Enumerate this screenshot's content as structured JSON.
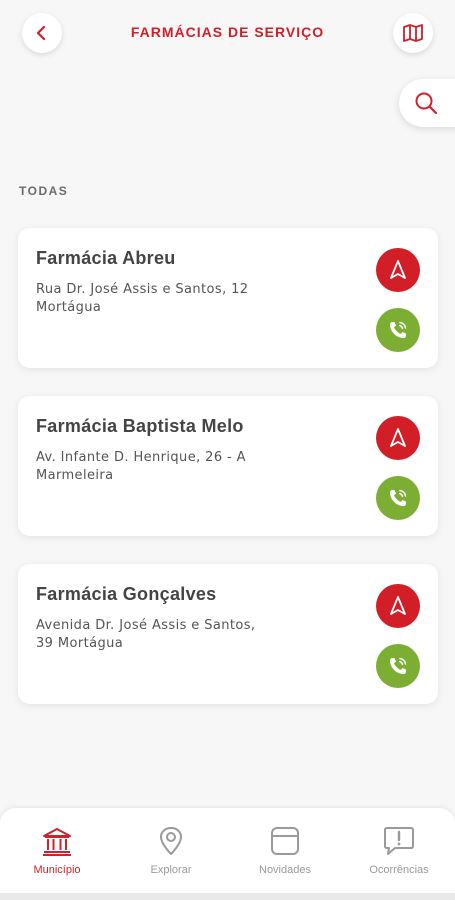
{
  "header": {
    "title": "FARMÁCIAS DE SERVIÇO",
    "back_icon": "chevron-left-icon",
    "map_icon": "map-icon",
    "search_icon": "search-icon"
  },
  "section": {
    "label": "TODAS"
  },
  "pharmacies": [
    {
      "name": "Farmácia Abreu",
      "address_line1": "Rua Dr. José Assis e Santos, 12",
      "address_line2": "Mortágua"
    },
    {
      "name": "Farmácia Baptista Melo",
      "address_line1": "Av. Infante D. Henrique, 26 - A",
      "address_line2": "Marmeleira"
    },
    {
      "name": "Farmácia Gonçalves",
      "address_line1": "Avenida Dr. José Assis e Santos,",
      "address_line2": "39 Mortágua"
    }
  ],
  "bottom_nav": {
    "items": [
      {
        "label": "Município",
        "icon": "building-columns-icon",
        "active": true
      },
      {
        "label": "Explorar",
        "icon": "map-pin-icon",
        "active": false
      },
      {
        "label": "Novidades",
        "icon": "news-icon",
        "active": false
      },
      {
        "label": "Ocorrências",
        "icon": "alert-message-icon",
        "active": false
      }
    ]
  },
  "colors": {
    "accent": "#d0202a",
    "navigate_button": "#d21f27",
    "call_button": "#7cae33",
    "inactive": "#9a9a9a"
  }
}
